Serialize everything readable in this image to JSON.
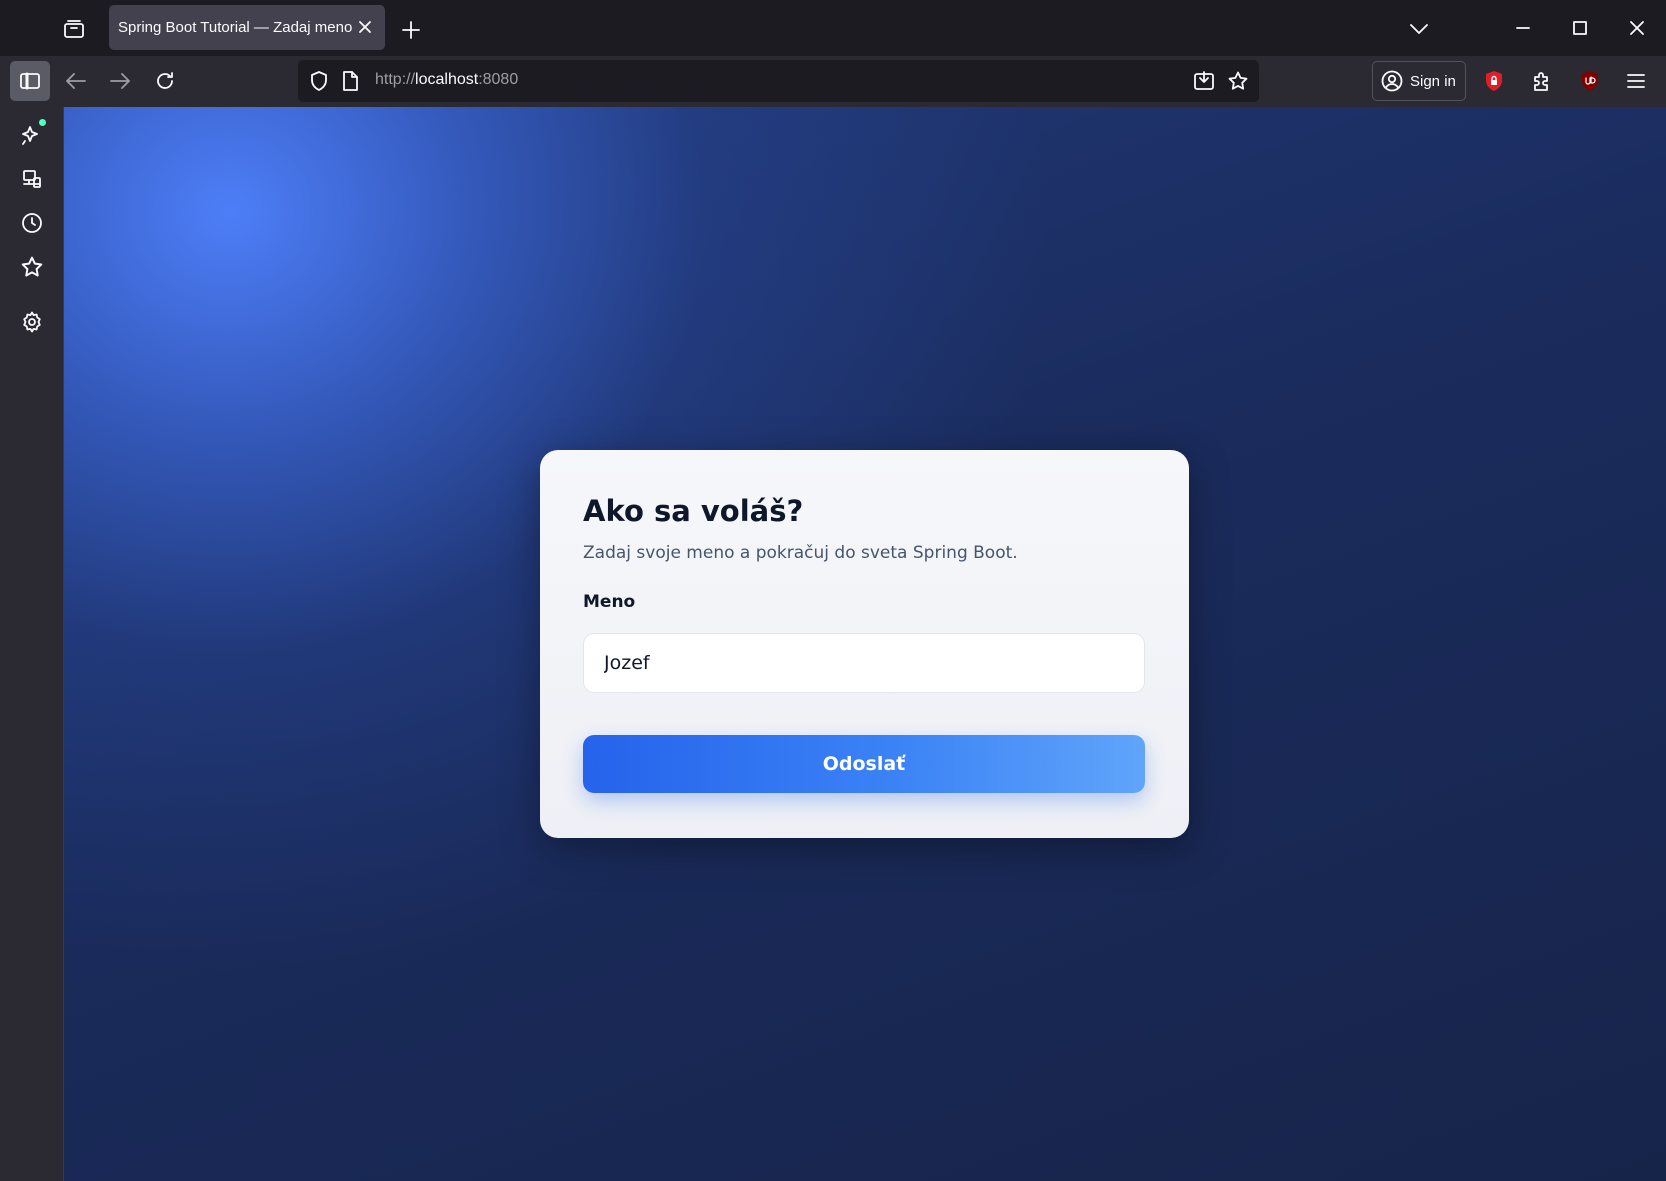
{
  "browser": {
    "tab": {
      "title": "Spring Boot Tutorial — Zadaj meno"
    },
    "url": {
      "scheme": "http://",
      "host": "localhost",
      "port": ":8080"
    },
    "account": {
      "signin_label": "Sign in"
    }
  },
  "page": {
    "heading": "Ako sa voláš?",
    "subtitle": "Zadaj svoje meno a pokračuj do sveta Spring Boot.",
    "name_label": "Meno",
    "name_value": "Jozef",
    "submit_label": "Odoslať"
  },
  "theme": {
    "page_background": "#17244a",
    "accent": "#3b82f6",
    "card_background": "#f4f5f8"
  }
}
